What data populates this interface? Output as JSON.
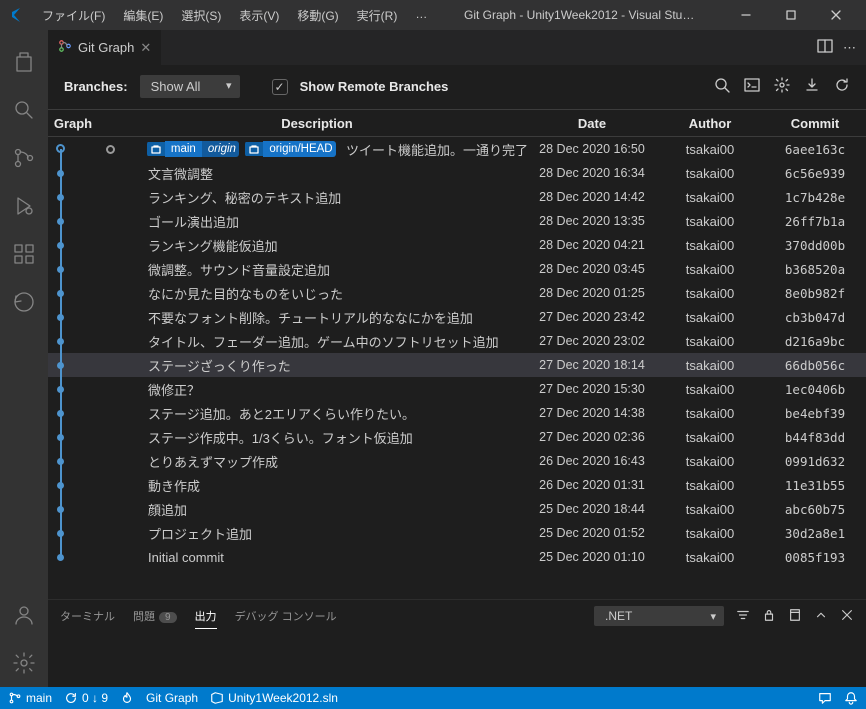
{
  "menubar": {
    "file": "ファイル(F)",
    "edit": "編集(E)",
    "select": "選択(S)",
    "view": "表示(V)",
    "go": "移動(G)",
    "run": "実行(R)",
    "more": "…"
  },
  "window_title": "Git Graph - Unity1Week2012 - Visual Stu…",
  "tab": {
    "title": "Git Graph"
  },
  "toolbar": {
    "branches_label": "Branches:",
    "branches_value": "Show All",
    "show_remote_label": "Show Remote Branches",
    "show_remote_checked": true
  },
  "columns": {
    "graph": "Graph",
    "description": "Description",
    "date": "Date",
    "author": "Author",
    "commit": "Commit"
  },
  "badges": {
    "main": "main",
    "origin": "origin",
    "origin_head": "origin/HEAD"
  },
  "commits": [
    {
      "desc": "ツイート機能追加。一通り完了",
      "date": "28 Dec 2020 16:50",
      "author": "tsakai00",
      "hash": "6aee163c",
      "head": true
    },
    {
      "desc": "文言微調整",
      "date": "28 Dec 2020 16:34",
      "author": "tsakai00",
      "hash": "6c56e939"
    },
    {
      "desc": "ランキング、秘密のテキスト追加",
      "date": "28 Dec 2020 14:42",
      "author": "tsakai00",
      "hash": "1c7b428e"
    },
    {
      "desc": "ゴール演出追加",
      "date": "28 Dec 2020 13:35",
      "author": "tsakai00",
      "hash": "26ff7b1a"
    },
    {
      "desc": "ランキング機能仮追加",
      "date": "28 Dec 2020 04:21",
      "author": "tsakai00",
      "hash": "370dd00b"
    },
    {
      "desc": "微調整。サウンド音量設定追加",
      "date": "28 Dec 2020 03:45",
      "author": "tsakai00",
      "hash": "b368520a"
    },
    {
      "desc": "なにか見た目的なものをいじった",
      "date": "28 Dec 2020 01:25",
      "author": "tsakai00",
      "hash": "8e0b982f"
    },
    {
      "desc": "不要なフォント削除。チュートリアル的ななにかを追加",
      "date": "27 Dec 2020 23:42",
      "author": "tsakai00",
      "hash": "cb3b047d"
    },
    {
      "desc": "タイトル、フェーダー追加。ゲーム中のソフトリセット追加",
      "date": "27 Dec 2020 23:02",
      "author": "tsakai00",
      "hash": "d216a9bc"
    },
    {
      "desc": "ステージざっくり作った",
      "date": "27 Dec 2020 18:14",
      "author": "tsakai00",
      "hash": "66db056c",
      "selected": true
    },
    {
      "desc": "微修正？",
      "date": "27 Dec 2020 15:30",
      "author": "tsakai00",
      "hash": "1ec0406b"
    },
    {
      "desc": "ステージ追加。あと2エリアくらい作りたい。",
      "date": "27 Dec 2020 14:38",
      "author": "tsakai00",
      "hash": "be4ebf39"
    },
    {
      "desc": "ステージ作成中。1/3くらい。フォント仮追加",
      "date": "27 Dec 2020 02:36",
      "author": "tsakai00",
      "hash": "b44f83dd"
    },
    {
      "desc": "とりあえずマップ作成",
      "date": "26 Dec 2020 16:43",
      "author": "tsakai00",
      "hash": "0991d632"
    },
    {
      "desc": "動き作成",
      "date": "26 Dec 2020 01:31",
      "author": "tsakai00",
      "hash": "11e31b55"
    },
    {
      "desc": "顔追加",
      "date": "25 Dec 2020 18:44",
      "author": "tsakai00",
      "hash": "abc60b75"
    },
    {
      "desc": "プロジェクト追加",
      "date": "25 Dec 2020 01:52",
      "author": "tsakai00",
      "hash": "30d2a8e1"
    },
    {
      "desc": "Initial commit",
      "date": "25 Dec 2020 01:10",
      "author": "tsakai00",
      "hash": "0085f193"
    }
  ],
  "panel": {
    "terminal": "ターミナル",
    "problems": "問題",
    "problems_count": "9",
    "output": "出力",
    "debug": "デバッグ コンソール",
    "channel": ".NET"
  },
  "statusbar": {
    "branch": "main",
    "sync": "0 ↓ 9",
    "gitgraph": "Git Graph",
    "solution": "Unity1Week2012.sln"
  }
}
